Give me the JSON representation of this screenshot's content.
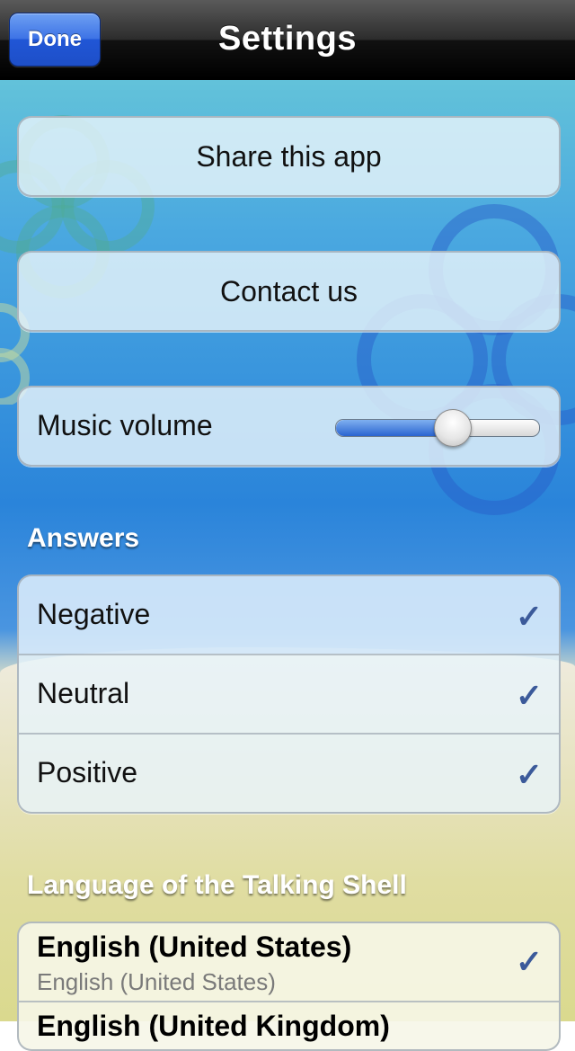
{
  "nav": {
    "title": "Settings",
    "done_label": "Done"
  },
  "actions": {
    "share_label": "Share this app",
    "contact_label": "Contact us"
  },
  "music": {
    "label": "Music volume",
    "volume_fraction": 0.57
  },
  "answers": {
    "header": "Answers",
    "items": [
      {
        "label": "Negative",
        "checked": true
      },
      {
        "label": "Neutral",
        "checked": true
      },
      {
        "label": "Positive",
        "checked": true
      }
    ]
  },
  "language": {
    "header": "Language of the Talking Shell",
    "items": [
      {
        "title": "English (United States)",
        "subtitle": "English (United States)",
        "checked": true
      },
      {
        "title": "English (United Kingdom)",
        "subtitle": "",
        "checked": false
      }
    ]
  },
  "icons": {
    "check": "checkmark-icon"
  },
  "colors": {
    "nav_bar": "#000000",
    "done_button": "#2a5fd8",
    "check": "#3b5a9a",
    "slider_fill": "#2a64d0"
  }
}
